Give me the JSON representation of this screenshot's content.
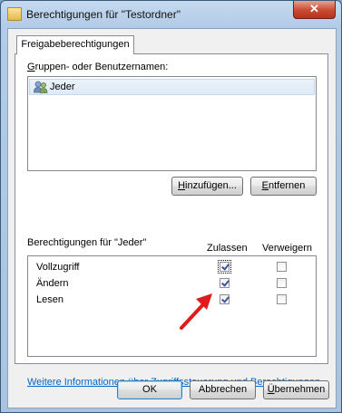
{
  "window": {
    "title": "Berechtigungen für \"Testordner\"",
    "close_symbol": "✕"
  },
  "tab": {
    "label": "Freigabeberechtigungen"
  },
  "groups": {
    "label_underlined": "G",
    "label_rest": "ruppen- oder Benutzernamen:",
    "items": [
      {
        "name": "Jeder",
        "icon": "users-icon"
      }
    ]
  },
  "buttons": {
    "add": {
      "underlined": "H",
      "rest": "inzufügen..."
    },
    "remove": {
      "underlined": "E",
      "rest": "ntfernen"
    }
  },
  "permissions": {
    "heading": "Berechtigungen für \"Jeder\"",
    "allow_header": "Zulassen",
    "deny_header": "Verweigern",
    "rows": [
      {
        "name": "Vollzugriff",
        "allow": true,
        "deny": false
      },
      {
        "name": "Ändern",
        "allow": true,
        "deny": false
      },
      {
        "name": "Lesen",
        "allow": true,
        "deny": false
      }
    ]
  },
  "link": {
    "text": "Weitere Informationen über Zugriffssteuerung und Berechtigungen"
  },
  "footer": {
    "ok": "OK",
    "cancel": "Abbrechen",
    "apply": {
      "underlined": "Ü",
      "rest": "bernehmen"
    }
  },
  "colors": {
    "arrow": "#e11b1b",
    "link": "#0066cc"
  }
}
